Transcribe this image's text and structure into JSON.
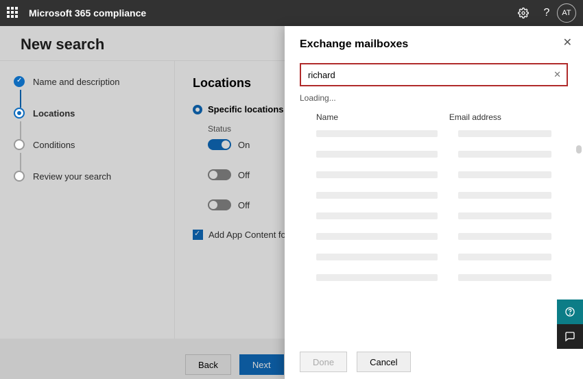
{
  "topbar": {
    "title": "Microsoft 365 compliance",
    "avatar": "AT"
  },
  "page": {
    "heading": "New search"
  },
  "stepper": {
    "items": [
      {
        "label": "Name and description"
      },
      {
        "label": "Locations"
      },
      {
        "label": "Conditions"
      },
      {
        "label": "Review your search"
      }
    ]
  },
  "main": {
    "title": "Locations",
    "radio_label": "Specific locations",
    "status_label": "Status",
    "rows": [
      {
        "state": "On"
      },
      {
        "state": "Off"
      },
      {
        "state": "Off"
      }
    ],
    "checkbox_label": "Add App Content for O"
  },
  "footer": {
    "back": "Back",
    "next": "Next"
  },
  "flyout": {
    "title": "Exchange mailboxes",
    "search_value": "richard",
    "loading": "Loading...",
    "col_name": "Name",
    "col_email": "Email address",
    "done": "Done",
    "cancel": "Cancel"
  }
}
